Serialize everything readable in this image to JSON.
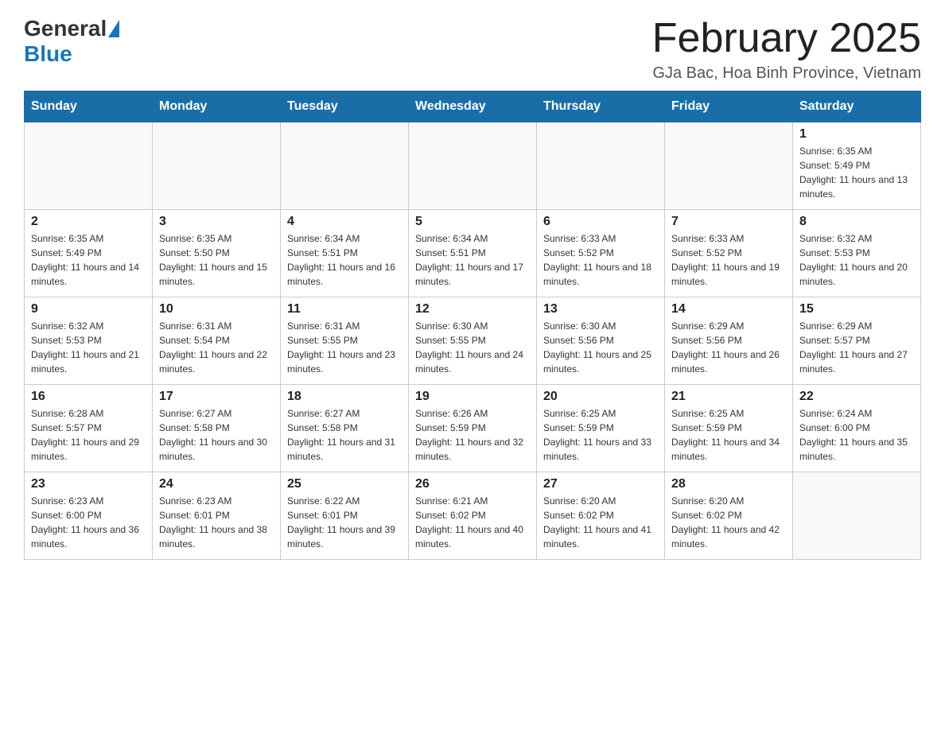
{
  "header": {
    "logo": {
      "general": "General",
      "blue": "Blue"
    },
    "title": "February 2025",
    "location": "GJa Bac, Hoa Binh Province, Vietnam"
  },
  "weekdays": [
    "Sunday",
    "Monday",
    "Tuesday",
    "Wednesday",
    "Thursday",
    "Friday",
    "Saturday"
  ],
  "weeks": [
    [
      {
        "day": "",
        "info": ""
      },
      {
        "day": "",
        "info": ""
      },
      {
        "day": "",
        "info": ""
      },
      {
        "day": "",
        "info": ""
      },
      {
        "day": "",
        "info": ""
      },
      {
        "day": "",
        "info": ""
      },
      {
        "day": "1",
        "info": "Sunrise: 6:35 AM\nSunset: 5:49 PM\nDaylight: 11 hours and 13 minutes."
      }
    ],
    [
      {
        "day": "2",
        "info": "Sunrise: 6:35 AM\nSunset: 5:49 PM\nDaylight: 11 hours and 14 minutes."
      },
      {
        "day": "3",
        "info": "Sunrise: 6:35 AM\nSunset: 5:50 PM\nDaylight: 11 hours and 15 minutes."
      },
      {
        "day": "4",
        "info": "Sunrise: 6:34 AM\nSunset: 5:51 PM\nDaylight: 11 hours and 16 minutes."
      },
      {
        "day": "5",
        "info": "Sunrise: 6:34 AM\nSunset: 5:51 PM\nDaylight: 11 hours and 17 minutes."
      },
      {
        "day": "6",
        "info": "Sunrise: 6:33 AM\nSunset: 5:52 PM\nDaylight: 11 hours and 18 minutes."
      },
      {
        "day": "7",
        "info": "Sunrise: 6:33 AM\nSunset: 5:52 PM\nDaylight: 11 hours and 19 minutes."
      },
      {
        "day": "8",
        "info": "Sunrise: 6:32 AM\nSunset: 5:53 PM\nDaylight: 11 hours and 20 minutes."
      }
    ],
    [
      {
        "day": "9",
        "info": "Sunrise: 6:32 AM\nSunset: 5:53 PM\nDaylight: 11 hours and 21 minutes."
      },
      {
        "day": "10",
        "info": "Sunrise: 6:31 AM\nSunset: 5:54 PM\nDaylight: 11 hours and 22 minutes."
      },
      {
        "day": "11",
        "info": "Sunrise: 6:31 AM\nSunset: 5:55 PM\nDaylight: 11 hours and 23 minutes."
      },
      {
        "day": "12",
        "info": "Sunrise: 6:30 AM\nSunset: 5:55 PM\nDaylight: 11 hours and 24 minutes."
      },
      {
        "day": "13",
        "info": "Sunrise: 6:30 AM\nSunset: 5:56 PM\nDaylight: 11 hours and 25 minutes."
      },
      {
        "day": "14",
        "info": "Sunrise: 6:29 AM\nSunset: 5:56 PM\nDaylight: 11 hours and 26 minutes."
      },
      {
        "day": "15",
        "info": "Sunrise: 6:29 AM\nSunset: 5:57 PM\nDaylight: 11 hours and 27 minutes."
      }
    ],
    [
      {
        "day": "16",
        "info": "Sunrise: 6:28 AM\nSunset: 5:57 PM\nDaylight: 11 hours and 29 minutes."
      },
      {
        "day": "17",
        "info": "Sunrise: 6:27 AM\nSunset: 5:58 PM\nDaylight: 11 hours and 30 minutes."
      },
      {
        "day": "18",
        "info": "Sunrise: 6:27 AM\nSunset: 5:58 PM\nDaylight: 11 hours and 31 minutes."
      },
      {
        "day": "19",
        "info": "Sunrise: 6:26 AM\nSunset: 5:59 PM\nDaylight: 11 hours and 32 minutes."
      },
      {
        "day": "20",
        "info": "Sunrise: 6:25 AM\nSunset: 5:59 PM\nDaylight: 11 hours and 33 minutes."
      },
      {
        "day": "21",
        "info": "Sunrise: 6:25 AM\nSunset: 5:59 PM\nDaylight: 11 hours and 34 minutes."
      },
      {
        "day": "22",
        "info": "Sunrise: 6:24 AM\nSunset: 6:00 PM\nDaylight: 11 hours and 35 minutes."
      }
    ],
    [
      {
        "day": "23",
        "info": "Sunrise: 6:23 AM\nSunset: 6:00 PM\nDaylight: 11 hours and 36 minutes."
      },
      {
        "day": "24",
        "info": "Sunrise: 6:23 AM\nSunset: 6:01 PM\nDaylight: 11 hours and 38 minutes."
      },
      {
        "day": "25",
        "info": "Sunrise: 6:22 AM\nSunset: 6:01 PM\nDaylight: 11 hours and 39 minutes."
      },
      {
        "day": "26",
        "info": "Sunrise: 6:21 AM\nSunset: 6:02 PM\nDaylight: 11 hours and 40 minutes."
      },
      {
        "day": "27",
        "info": "Sunrise: 6:20 AM\nSunset: 6:02 PM\nDaylight: 11 hours and 41 minutes."
      },
      {
        "day": "28",
        "info": "Sunrise: 6:20 AM\nSunset: 6:02 PM\nDaylight: 11 hours and 42 minutes."
      },
      {
        "day": "",
        "info": ""
      }
    ]
  ]
}
